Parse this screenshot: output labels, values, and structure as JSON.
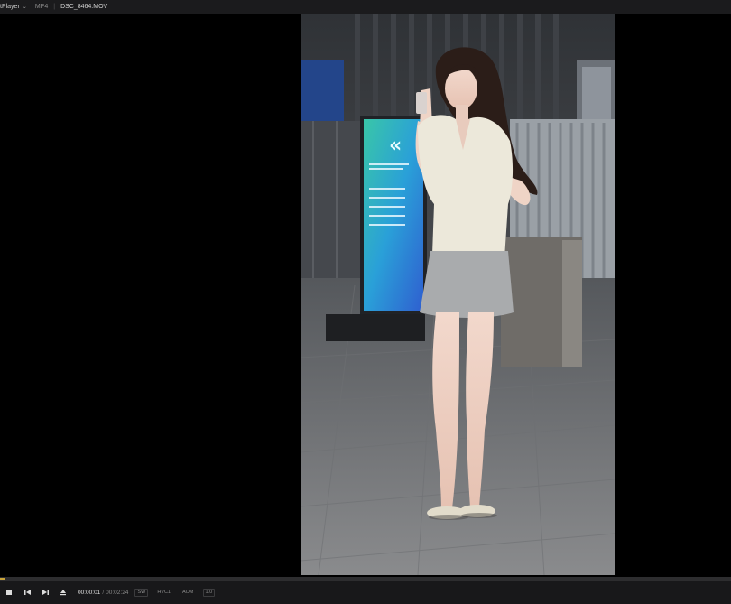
{
  "titlebar": {
    "app_name": "tPlayer",
    "format": "MP4",
    "separator": "|",
    "filename": "DSC_8464.MOV"
  },
  "icons": {
    "app_menu_chevron": "chevron-down-icon",
    "stop": "stop-icon",
    "previous": "skip-previous-icon",
    "next": "skip-next-icon",
    "eject": "eject-icon"
  },
  "controls": {
    "current_time": "00:00:01",
    "time_separator": "/",
    "total_time": "00:02:24",
    "tags": [
      "SW",
      "HVC1",
      "AOM",
      "1.0"
    ]
  },
  "playback": {
    "progress_fraction": 0.007
  },
  "colors": {
    "accent": "#c8a43a",
    "titlebar_bg": "#1b1b1d",
    "controls_bg": "#18181a"
  }
}
